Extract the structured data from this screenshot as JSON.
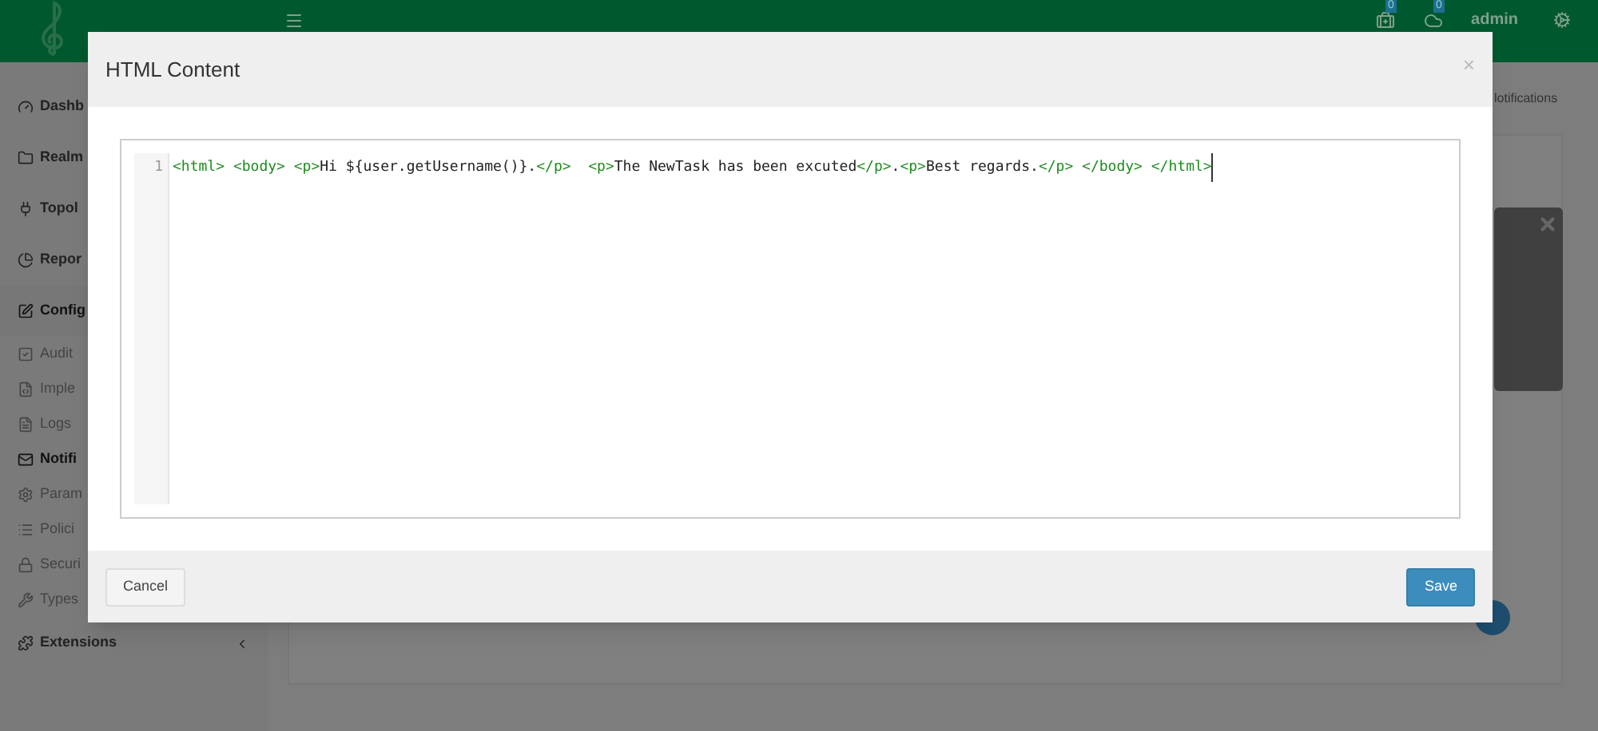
{
  "topbar": {
    "badges": [
      {
        "count": "0"
      },
      {
        "count": "0"
      }
    ],
    "user": "admin"
  },
  "sidebar": {
    "items": [
      {
        "kind": "section",
        "label": "Dashb",
        "selected": false
      },
      {
        "kind": "section",
        "label": "Realm",
        "selected": false
      },
      {
        "kind": "section",
        "label": "Topol",
        "selected": false
      },
      {
        "kind": "section",
        "label": "Repor",
        "selected": false
      },
      {
        "kind": "section",
        "label": "Config",
        "selected": true
      },
      {
        "kind": "sub",
        "label": "Audit",
        "selected": false
      },
      {
        "kind": "sub",
        "label": "Imple",
        "selected": false
      },
      {
        "kind": "sub",
        "label": "Logs",
        "selected": false
      },
      {
        "kind": "sub",
        "label": "Notifi",
        "selected": true
      },
      {
        "kind": "sub",
        "label": "Param",
        "selected": false
      },
      {
        "kind": "sub",
        "label": "Polici",
        "selected": false
      },
      {
        "kind": "sub",
        "label": "Securi",
        "selected": false
      },
      {
        "kind": "sub",
        "label": "Types",
        "selected": false
      },
      {
        "kind": "section",
        "label": "Extensions",
        "selected": false
      }
    ]
  },
  "breadcrumb": "lotifications",
  "modal": {
    "title": "HTML Content",
    "close": "×",
    "editor": {
      "line_number": "1",
      "tokens": [
        {
          "kind": "tag",
          "text": "<html> "
        },
        {
          "kind": "tag",
          "text": "<body> "
        },
        {
          "kind": "tag",
          "text": "<p>"
        },
        {
          "kind": "text",
          "text": "Hi ${user.getUsername()}."
        },
        {
          "kind": "tag",
          "text": "</p>  "
        },
        {
          "kind": "tag",
          "text": "<p>"
        },
        {
          "kind": "text",
          "text": "The NewTask has been excuted"
        },
        {
          "kind": "tag",
          "text": "</p>"
        },
        {
          "kind": "text",
          "text": "."
        },
        {
          "kind": "tag",
          "text": "<p>"
        },
        {
          "kind": "text",
          "text": "Best regards."
        },
        {
          "kind": "tag",
          "text": "</p> "
        },
        {
          "kind": "tag",
          "text": "</body> "
        },
        {
          "kind": "tag",
          "text": "</html>"
        }
      ]
    },
    "buttons": [
      {
        "kind": "secondary",
        "label": "Cancel"
      },
      {
        "kind": "primary",
        "label": "Save"
      }
    ]
  }
}
